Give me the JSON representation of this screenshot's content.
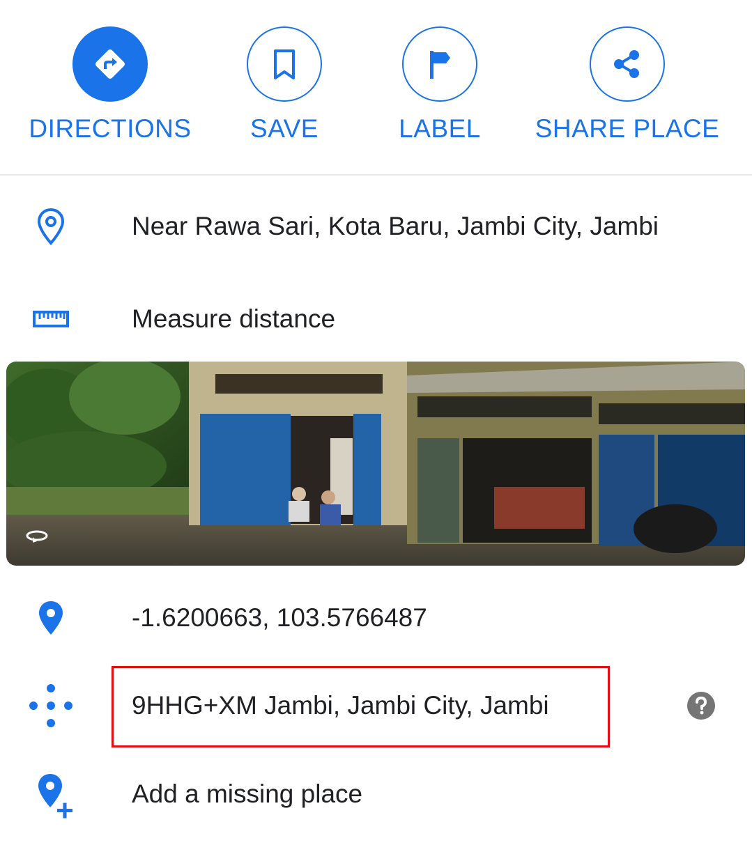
{
  "actions": {
    "directions": "DIRECTIONS",
    "save": "SAVE",
    "label": "LABEL",
    "share": "SHARE PLACE"
  },
  "details": {
    "address": "Near Rawa Sari, Kota Baru, Jambi City, Jambi",
    "measure": "Measure distance",
    "coordinates": "-1.6200663, 103.5766487",
    "plus_code": "9HHG+XM Jambi, Jambi City, Jambi",
    "add_place": "Add a missing place"
  },
  "colors": {
    "accent": "#1a73e8",
    "highlight": "#e01010",
    "text": "#202124"
  }
}
